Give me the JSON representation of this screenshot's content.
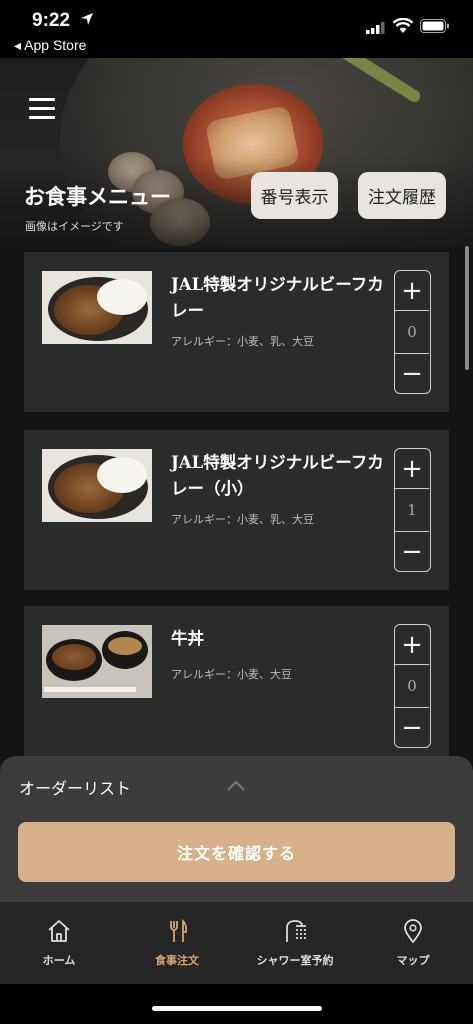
{
  "status_bar": {
    "time": "9:22",
    "back_app": "◂ App Store"
  },
  "header": {
    "title": "お食事メニュー",
    "subtitle": "画像はイメージです",
    "number_button": "番号表示",
    "history_button": "注文履歴"
  },
  "menu_items": [
    {
      "name": "JAL特製オリジナルビーフカレー",
      "allergy": "アレルギー：小麦、乳、大豆",
      "quantity": "0",
      "plus": "+",
      "minus": "−"
    },
    {
      "name": "JAL特製オリジナルビーフカレー（小）",
      "allergy": "アレルギー：小麦、乳、大豆",
      "quantity": "1",
      "plus": "+",
      "minus": "−"
    },
    {
      "name": "牛丼",
      "allergy": "アレルギー：小麦、大豆",
      "quantity": "0",
      "plus": "+",
      "minus": "−"
    }
  ],
  "order_panel": {
    "title": "オーダーリスト",
    "confirm_button": "注文を確認する"
  },
  "tabbar": {
    "tabs": [
      {
        "label": "ホーム",
        "icon": "home-icon"
      },
      {
        "label": "食事注文",
        "icon": "fork-knife-icon",
        "active": true
      },
      {
        "label": "シャワー室予約",
        "icon": "shower-icon"
      },
      {
        "label": "マップ",
        "icon": "map-pin-icon"
      }
    ]
  },
  "colors": {
    "accent": "#d6b18a",
    "active_tab": "#d8a56e",
    "card": "#2b2b2b",
    "panel": "#3b3b3b"
  }
}
